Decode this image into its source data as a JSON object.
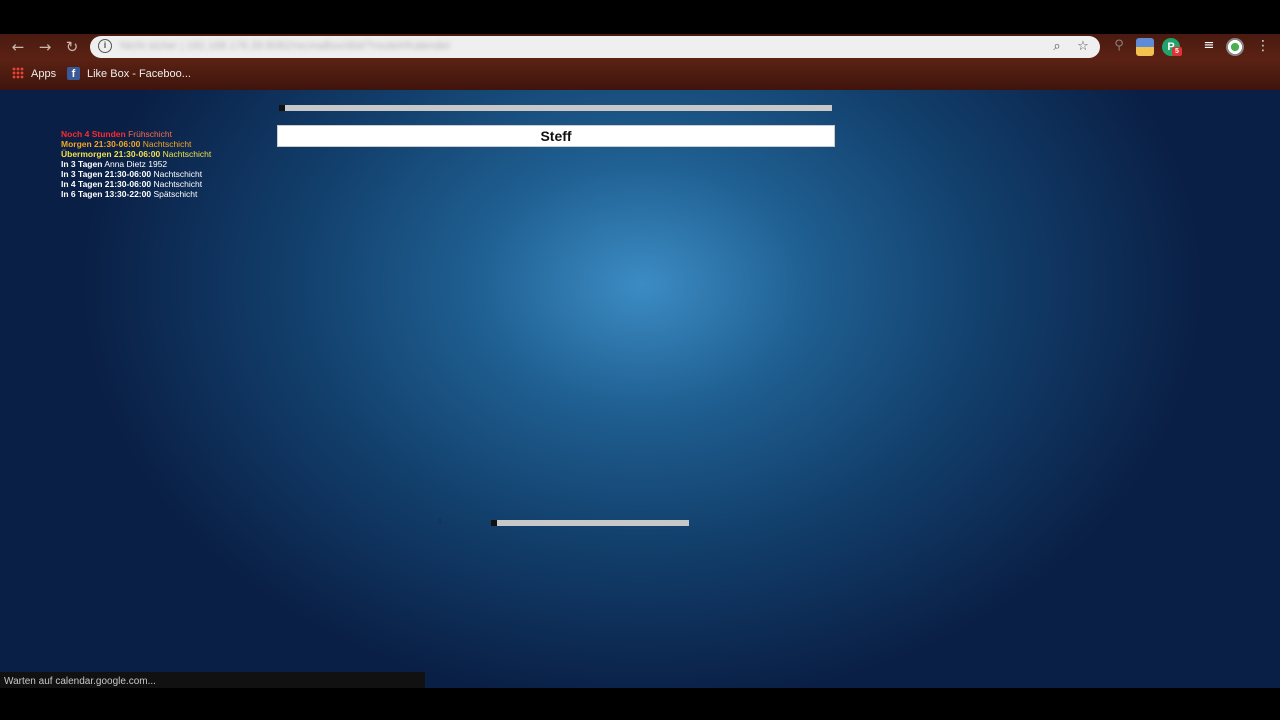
{
  "browser": {
    "address": "Nicht sicher | 192.168.178.39:8082/recmaBox/dist/?route#/Kalender",
    "bookmarks": [
      {
        "label": "Apps",
        "icon": "apps-grid-icon"
      },
      {
        "label": "Like Box - Faceboo...",
        "icon": "facebook-icon"
      }
    ],
    "status_text": "Warten auf calendar.google.com...",
    "extension_badge": "5"
  },
  "colors": {
    "accent_red": "#ff2222",
    "accent_orange": "#f5a623",
    "accent_yellow": "#f2e14c",
    "panel_white": "#ffffff",
    "background_blue": "#1f5f91"
  },
  "upcoming": [
    {
      "when": "Noch 4 Stunden",
      "detail": "Frühschicht",
      "color": "#ff2a2a",
      "detail_color": "#ff6a4a"
    },
    {
      "when": "Morgen 21:30-06:00",
      "detail": "Nachtschicht",
      "color": "#f5a623",
      "detail_color": "#f5a623"
    },
    {
      "when": "Übermorgen 21:30-06:00",
      "detail": "Nachtschicht",
      "color": "#f2e14c",
      "detail_color": "#f2e14c"
    },
    {
      "when": "In 3 Tagen",
      "detail": "Anna Dietz 1952",
      "color": "#ffffff",
      "detail_color": "#ffffff"
    },
    {
      "when": "In 3 Tagen 21:30-06:00",
      "detail": "Nachtschicht",
      "color": "#ffffff",
      "detail_color": "#ffffff"
    },
    {
      "when": "In 4 Tagen 21:30-06:00",
      "detail": "Nachtschicht",
      "color": "#ffffff",
      "detail_color": "#ffffff"
    },
    {
      "when": "In 6 Tagen 13:30-22:00",
      "detail": "Spätschicht",
      "color": "#ffffff",
      "detail_color": "#ffffff"
    }
  ],
  "main": {
    "name": "Steff",
    "top_progress": 0.01,
    "bottom_progress": 0.03
  }
}
